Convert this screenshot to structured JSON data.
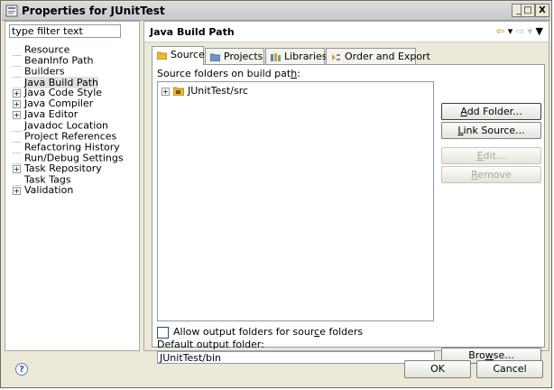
{
  "window": {
    "title": "Properties for JUnitTest",
    "minimize_label": "_",
    "maximize_label": "□",
    "close_label": "X"
  },
  "filter": {
    "value": "type filter text"
  },
  "tree": [
    {
      "label": "Resource",
      "expandable": false
    },
    {
      "label": "BeanInfo Path",
      "expandable": false
    },
    {
      "label": "Builders",
      "expandable": false
    },
    {
      "label": "Java Build Path",
      "expandable": false,
      "selected": true
    },
    {
      "label": "Java Code Style",
      "expandable": true
    },
    {
      "label": "Java Compiler",
      "expandable": true
    },
    {
      "label": "Java Editor",
      "expandable": true
    },
    {
      "label": "Javadoc Location",
      "expandable": false
    },
    {
      "label": "Project References",
      "expandable": false
    },
    {
      "label": "Refactoring History",
      "expandable": false
    },
    {
      "label": "Run/Debug Settings",
      "expandable": false
    },
    {
      "label": "Task Repository",
      "expandable": true
    },
    {
      "label": "Task Tags",
      "expandable": false
    },
    {
      "label": "Validation",
      "expandable": true
    }
  ],
  "page": {
    "title": "Java Build Path"
  },
  "tabs": [
    {
      "label": "Source",
      "active": true
    },
    {
      "label": "Projects",
      "active": false
    },
    {
      "label": "Libraries",
      "active": false
    },
    {
      "label": "Order and Export",
      "active": false
    }
  ],
  "source": {
    "list_label": "Source folders on build path:",
    "items": [
      "JUnitTest/src"
    ],
    "buttons": {
      "add_folder": "Add Folder...",
      "link_source": "Link Source...",
      "edit": "Edit...",
      "remove": "Remove",
      "browse": "Browse..."
    },
    "allow_output_label": "Allow output folders for source folders",
    "default_output_label": "Default output folder:",
    "default_output_value": "JUnitTest/bin"
  },
  "dialog": {
    "ok": "OK",
    "cancel": "Cancel",
    "help_glyph": "?"
  },
  "colors": {
    "dialog_bg": "#ece9d8",
    "folder_icon": "#e8b830",
    "nav_arrow": "#d08000"
  }
}
